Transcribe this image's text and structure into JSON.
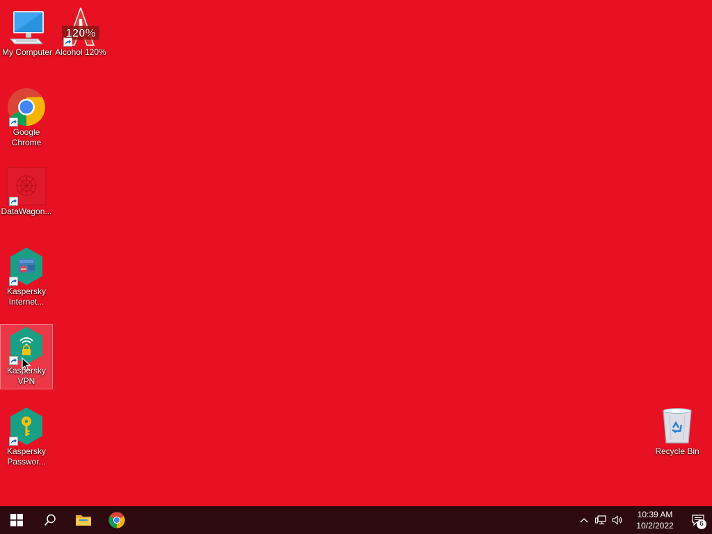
{
  "desktop": {
    "background_color": "#e81123",
    "icons": [
      {
        "label": "My Computer",
        "icon": "computer-icon"
      },
      {
        "label": "Alcohol 120%",
        "icon": "alcohol-120-icon",
        "icon_text": "120%"
      },
      {
        "label": "Google Chrome",
        "icon": "chrome-icon"
      },
      {
        "label": "DataWagon...",
        "icon": "datawagon-icon"
      },
      {
        "label": "Kaspersky Internet...",
        "icon": "kaspersky-internet-security-icon"
      },
      {
        "label": "Kaspersky VPN",
        "icon": "kaspersky-vpn-icon",
        "selected": true
      },
      {
        "label": "Kaspersky Passwor...",
        "icon": "kaspersky-password-manager-icon"
      },
      {
        "label": "Recycle Bin",
        "icon": "recycle-bin-icon"
      }
    ]
  },
  "taskbar": {
    "background_color": "#2c0a0f",
    "pinned": [
      {
        "name": "start",
        "icon": "windows-logo-icon"
      },
      {
        "name": "search",
        "icon": "search-icon"
      },
      {
        "name": "file-explorer",
        "icon": "folder-icon"
      },
      {
        "name": "google-chrome",
        "icon": "chrome-icon"
      }
    ],
    "tray": {
      "icons": [
        "chevron-up-icon",
        "network-icon",
        "volume-icon"
      ],
      "time": "10:39 AM",
      "date": "10/2/2022",
      "notification_count": "6"
    }
  }
}
